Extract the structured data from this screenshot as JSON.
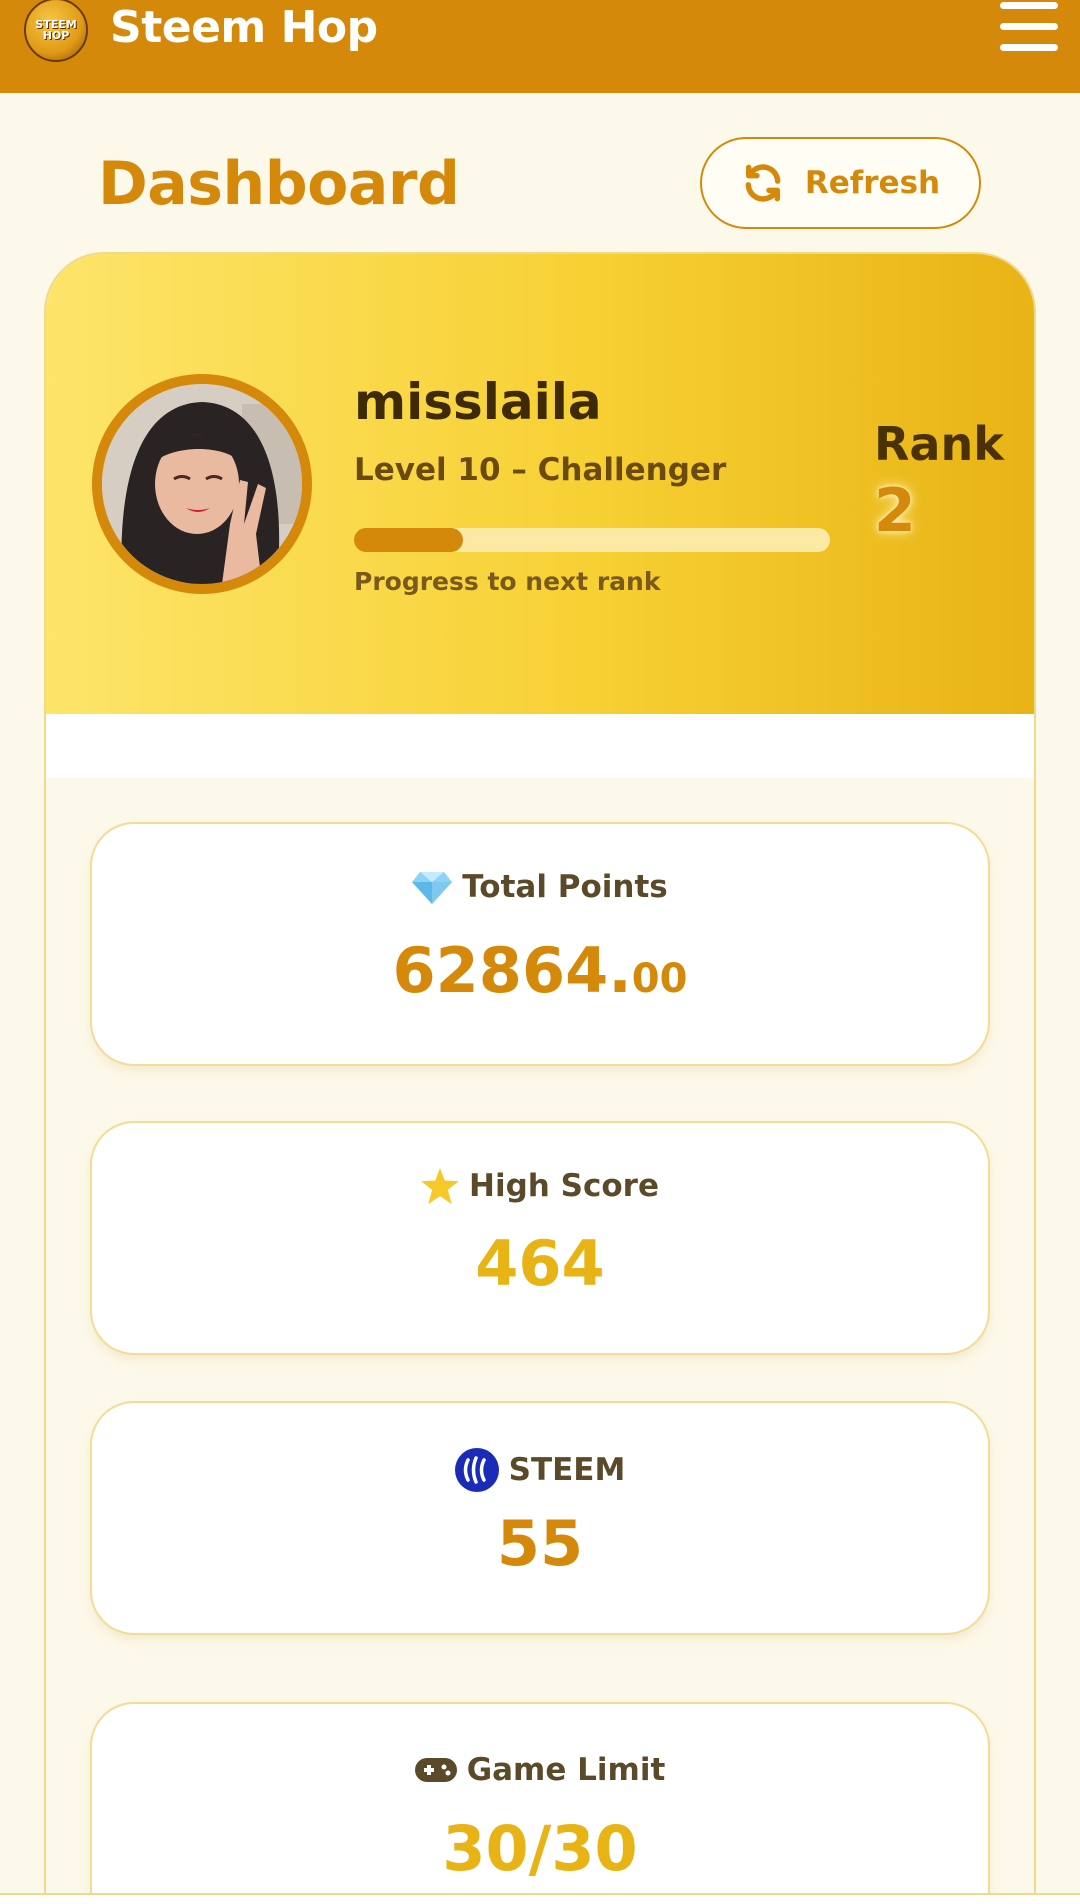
{
  "header": {
    "logo_text": [
      "STEEM",
      "HOP"
    ],
    "app_title": "Steem Hop",
    "menu_icon": "hamburger-menu-icon"
  },
  "page": {
    "title": "Dashboard",
    "refresh_label": "Refresh",
    "refresh_icon": "refresh-icon"
  },
  "profile": {
    "username": "misslaila",
    "level": "Level 10 – Challenger",
    "progress_fraction": 0.23,
    "progress_label": "Progress to next rank",
    "rank_label": "Rank",
    "rank_value": "2"
  },
  "stats": {
    "total_points": {
      "icon": "diamond-icon",
      "label": "Total Points",
      "value_int": "62864.",
      "value_dec": "00"
    },
    "high_score": {
      "icon": "star-icon",
      "label": "High Score",
      "value": "464"
    },
    "steem": {
      "icon": "steem-logo-icon",
      "label": "STEEM",
      "value": "55"
    },
    "game_limit": {
      "icon": "gamepad-icon",
      "label": "Game Limit",
      "value": "30/30"
    }
  },
  "colors": {
    "brand": "#d4890a",
    "gold_light": "#fde56a",
    "gold_dark": "#e8b315",
    "highscore": "#e8b315",
    "steem_blue": "#1a2bb8"
  }
}
